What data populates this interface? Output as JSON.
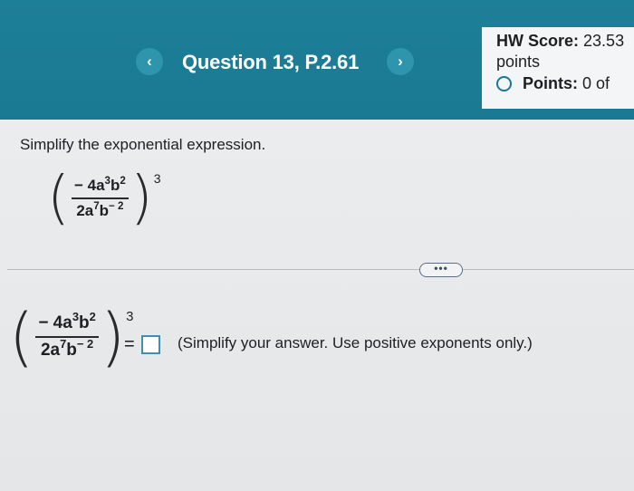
{
  "header": {
    "question_title": "Question 13, P.2.61",
    "prev_icon": "‹",
    "next_icon": "›"
  },
  "score": {
    "hw_label": "HW Score:",
    "hw_value": "23.53",
    "hw_unit": "points",
    "points_label": "Points:",
    "points_value": "0 of"
  },
  "problem": {
    "instruction": "Simplify the exponential expression.",
    "expression": {
      "num_coef": "− 4a",
      "num_a_exp": "3",
      "num_b": "b",
      "num_b_exp": "2",
      "den_coef": "2a",
      "den_a_exp": "7",
      "den_b": "b",
      "den_b_exp": "− 2",
      "outer_exp": "3",
      "lparen": "(",
      "rparen": ")"
    }
  },
  "more_button": "•••",
  "answer": {
    "equals": "=",
    "hint": "(Simplify your answer. Use positive exponents only.)"
  },
  "colors": {
    "header_bg": "#1a7993",
    "nav_button": "#2e95ad",
    "answer_box_border": "#3f8fb0"
  },
  "icons": {
    "prev": "chevron-left-icon",
    "next": "chevron-right-icon",
    "points_status": "radio-ring-icon"
  }
}
